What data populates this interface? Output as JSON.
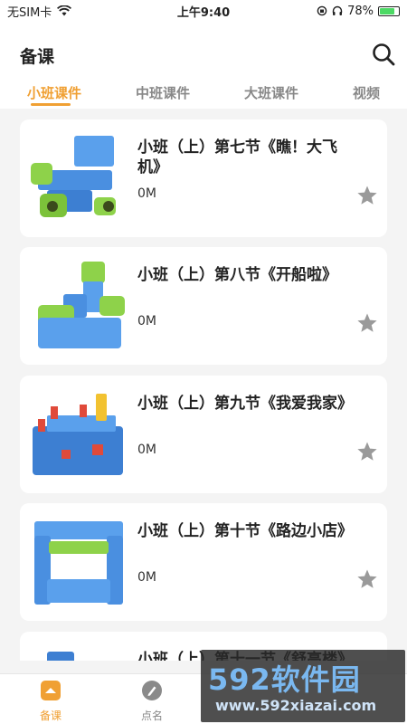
{
  "status_bar": {
    "carrier": "无SIM卡",
    "time": "上午9:40",
    "battery": "78%",
    "battery_level": 0.78
  },
  "header": {
    "title": "备课",
    "search_icon": "search-icon"
  },
  "tabs": [
    {
      "label": "小班课件",
      "active": true
    },
    {
      "label": "中班课件",
      "active": false
    },
    {
      "label": "大班课件",
      "active": false
    },
    {
      "label": "视频",
      "active": false
    }
  ],
  "courses": [
    {
      "title": "小班（上）第七节《瞧！大飞机》",
      "size": "0M"
    },
    {
      "title": "小班（上）第八节《开船啦》",
      "size": "0M"
    },
    {
      "title": "小班（上）第九节《我爱我家》",
      "size": "0M"
    },
    {
      "title": "小班（上）第十节《路边小店》",
      "size": "0M"
    },
    {
      "title": "小班（上）第十一节《舒高楼》",
      "size": ""
    }
  ],
  "tabbar": [
    {
      "label": "备课",
      "icon": "home-icon",
      "active": true
    },
    {
      "label": "点名",
      "icon": "pen-icon",
      "active": false
    }
  ],
  "watermark": {
    "logo": "592软件园",
    "url": "www.592xiazai.com"
  },
  "colors": {
    "accent": "#f0a033",
    "star": "#9a9a9a",
    "background": "#f4f4f4"
  }
}
